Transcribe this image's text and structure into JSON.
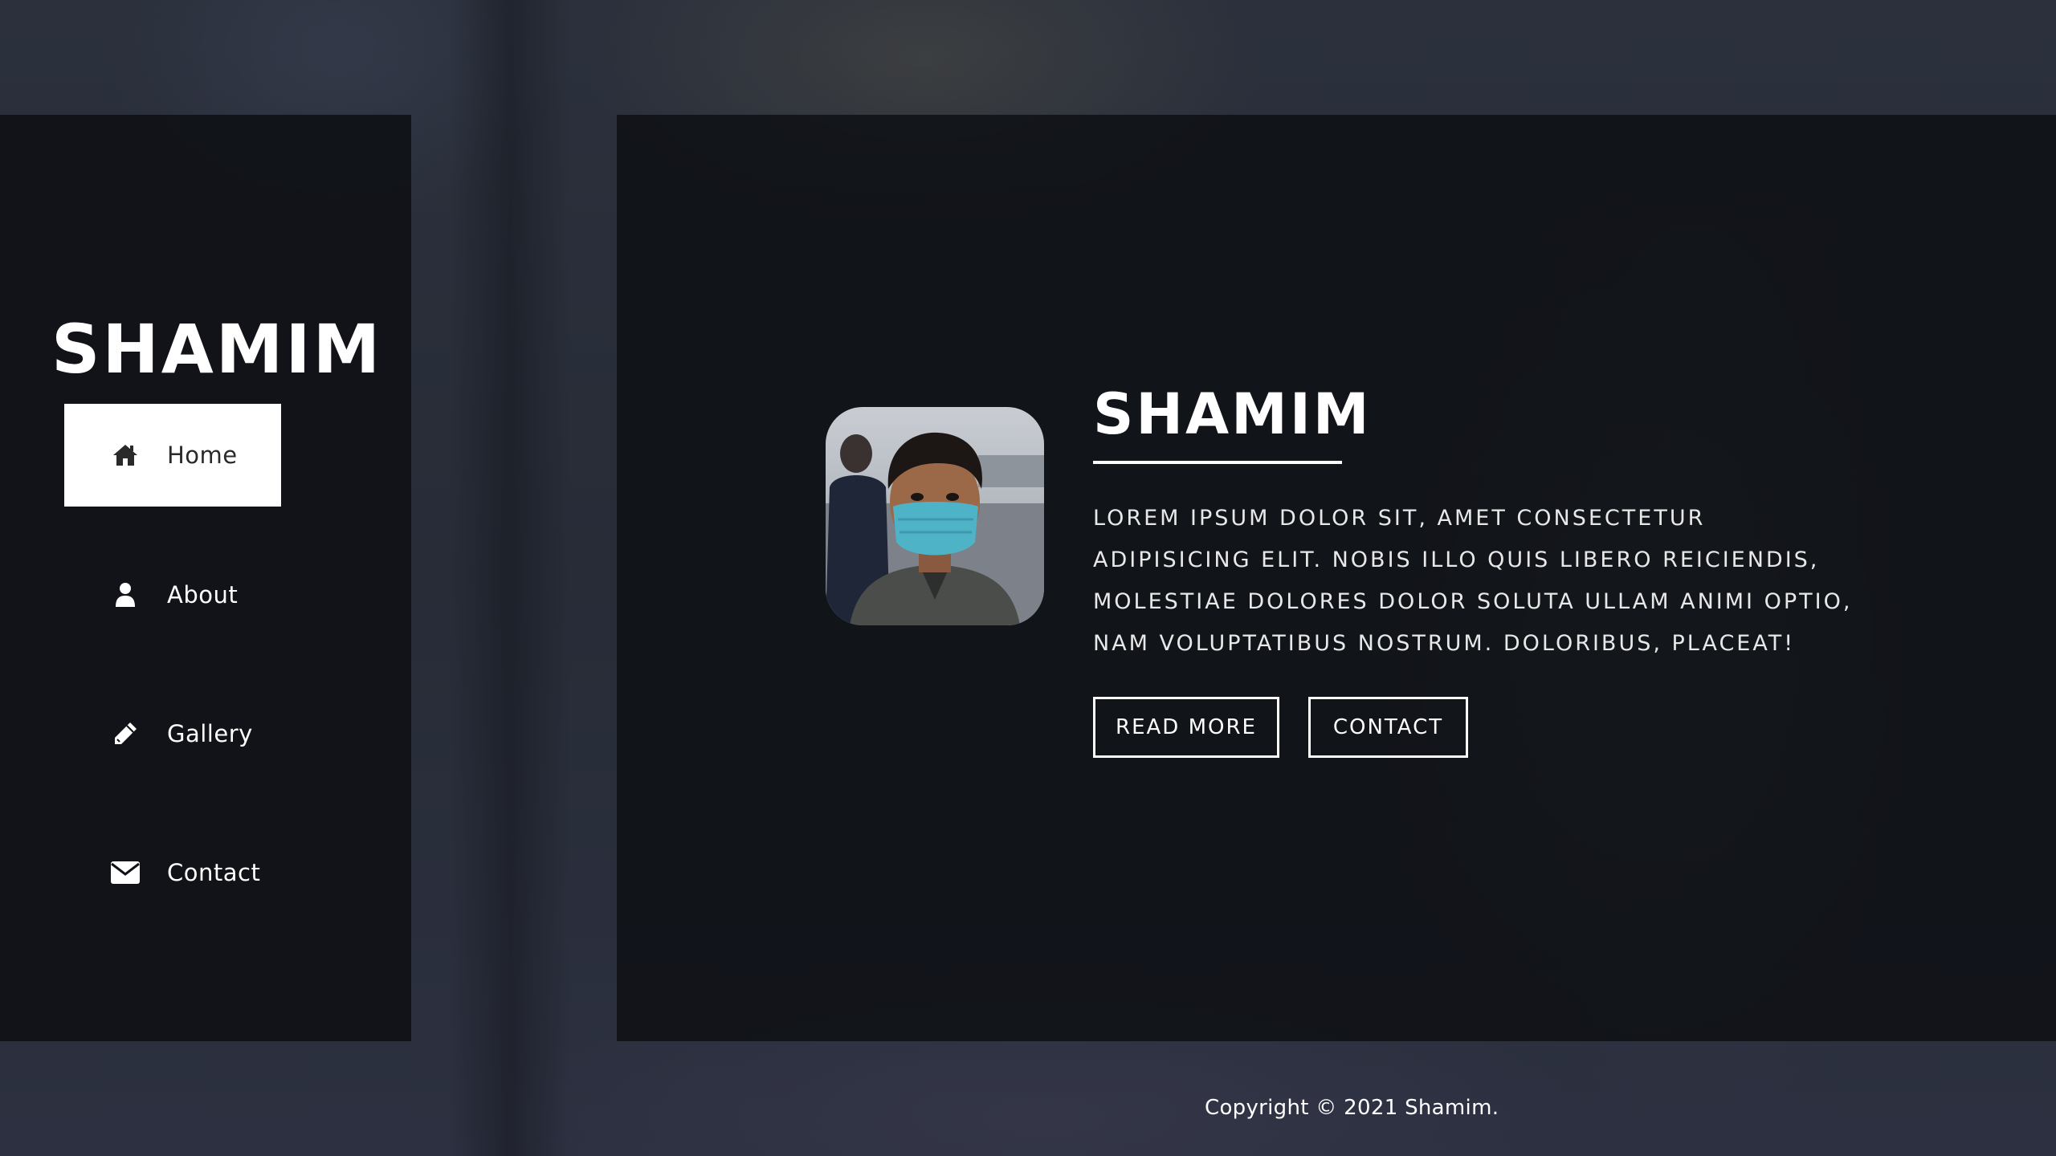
{
  "sidebar": {
    "logo": "SHAMIM",
    "items": [
      {
        "label": "Home",
        "icon": "home-icon",
        "active": true
      },
      {
        "label": "About",
        "icon": "user-icon",
        "active": false
      },
      {
        "label": "Gallery",
        "icon": "pencil-icon",
        "active": false
      },
      {
        "label": "Contact",
        "icon": "envelope-icon",
        "active": false
      }
    ]
  },
  "hero": {
    "title": "SHAMIM",
    "description": "Lorem ipsum dolor sit, amet consectetur adipisicing elit. Nobis illo quis libero reiciendis, molestiae dolores dolor soluta ullam animi optio, nam voluptatibus nostrum. Doloribus, placeat!",
    "read_more_label": "READ MORE",
    "contact_label": "CONTACT"
  },
  "footer": {
    "copyright": "Copyright © 2021 Shamim."
  },
  "colors": {
    "panel": "#0f1116",
    "accent": "#ffffff",
    "mask": "#4fb3c8"
  }
}
